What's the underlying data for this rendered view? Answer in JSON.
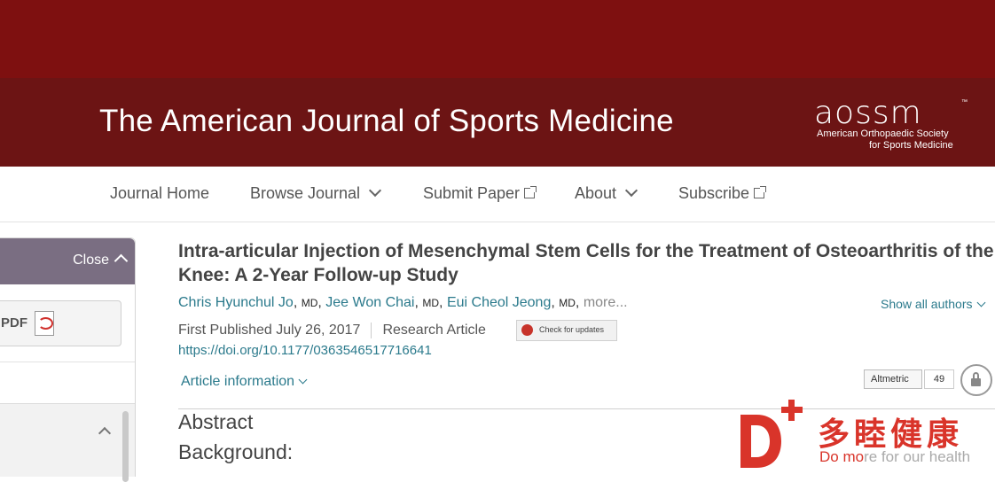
{
  "header": {
    "journal_title": "The American Journal of Sports Medicine",
    "logo": {
      "wordmark": "aossm",
      "tm": "™",
      "line1": "American Orthopaedic Society",
      "line2": "for Sports Medicine"
    }
  },
  "nav": {
    "items": [
      {
        "label": "Journal Home",
        "icon": ""
      },
      {
        "label": "Browse Journal",
        "icon": "chevron-down-icon"
      },
      {
        "label": "Submit Paper",
        "icon": "external-link-icon"
      },
      {
        "label": "About",
        "icon": "chevron-down-icon"
      },
      {
        "label": "Subscribe",
        "icon": "external-link-icon"
      }
    ]
  },
  "sidebar": {
    "close_label": "Close",
    "pdf_label": "PDF"
  },
  "article": {
    "title": "Intra-articular Injection of Mesenchymal Stem Cells for the Treatment of Osteoarthritis of the Knee: A 2-Year Follow-up Study",
    "authors": [
      {
        "name": "Chris Hyunchul Jo",
        "degree": "MD"
      },
      {
        "name": "Jee Won Chai",
        "degree": "MD"
      },
      {
        "name": "Eui Cheol Jeong",
        "degree": "MD"
      }
    ],
    "more": "more...",
    "show_all_authors": "Show all authors",
    "first_published": "First Published July 26, 2017",
    "article_type": "Research Article",
    "check_updates": "Check for updates",
    "doi": "https://doi.org/10.1177/0363546517716641",
    "article_information": "Article information",
    "altmetric_label": "Altmetric",
    "altmetric_score": "49",
    "abstract_heading": "Abstract",
    "background_heading": "Background:"
  },
  "watermark": {
    "chinese": "多睦健康",
    "english_highlight": "Do mo",
    "english_rest": "re for our health",
    "color": "#d9342a"
  },
  "colors": {
    "top_bar": "#7e1010",
    "header": "#6c1414",
    "link": "#2b7a8c",
    "sidebar_header": "#7a6e82"
  }
}
